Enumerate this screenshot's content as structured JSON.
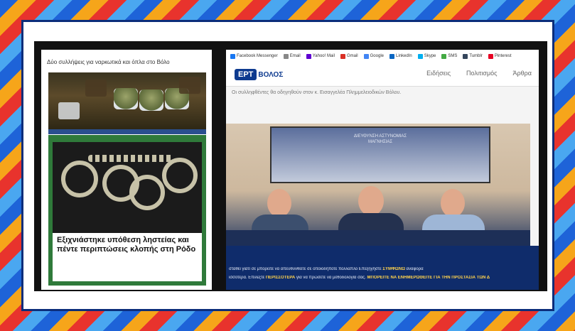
{
  "left_panel": {
    "headline_small": "Δύο συλλήψεις για ναρκωτικά και όπλα στο Βόλο",
    "headline_large": "Εξιχνιάστηκε υπόθεση ληστείας και πέντε περιπτώσεις κλοπής στη Ρόδο"
  },
  "right_panel": {
    "share_bar": [
      {
        "label": "Facebook Messenger",
        "color": "#1877f2"
      },
      {
        "label": "Email",
        "color": "#888888"
      },
      {
        "label": "Yahoo! Mail",
        "color": "#5f01d1"
      },
      {
        "label": "Gmail",
        "color": "#d93025"
      },
      {
        "label": "Google",
        "color": "#4285f4"
      },
      {
        "label": "LinkedIn",
        "color": "#0a66c2"
      },
      {
        "label": "Skype",
        "color": "#00aff0"
      },
      {
        "label": "SMS",
        "color": "#44aa44"
      },
      {
        "label": "Tumblr",
        "color": "#35465c"
      },
      {
        "label": "Pinterest",
        "color": "#e60023"
      }
    ],
    "logo": {
      "box": "ΕΡΤ",
      "text": "ΒΟΛΟΣ"
    },
    "nav_links": [
      "Ειδήσεις",
      "Πολιτισμός",
      "Άρθρα"
    ],
    "article_paragraphs": [
      "Οι συλληφθέντες θα οδηγηθούν στον κ. Εισαγγελέα Πλημμελειοδικών Βόλου."
    ],
    "screen_text": [
      "ΔΙΕΥΘΥΝΣΗ ΑΣΤΥΝΟΜΙΑΣ",
      "ΜΑΓΝΗΣΙΑΣ"
    ],
    "ticker": {
      "line1_before": "σταθεί γιατί σε μπορείτε να απευθυνθείτε σε οποιοδήποτε πολλαπλό Επεξηγήστε ",
      "line1_bold": "ΣΥΜΦΩΝΩ",
      "line1_after": " αναφορά",
      "line2_before": "ισσότερα. Επιλέξτε ",
      "line2_bold1": "ΠΕΡΙΣΣΟΤΕΡΑ",
      "line2_mid": " για να πρώσετε να μεθοδολογία σας. ",
      "line2_bold2": "ΜΠΟΡΕΙΤΕ ΝΑ ΕΝΗΜΕΡΩΘΕΙΤΕ ΓΙΑ ΤΗΝ ΠΡΟΣΤΑΣΙΑ ΤΩΝ Δ"
    }
  }
}
